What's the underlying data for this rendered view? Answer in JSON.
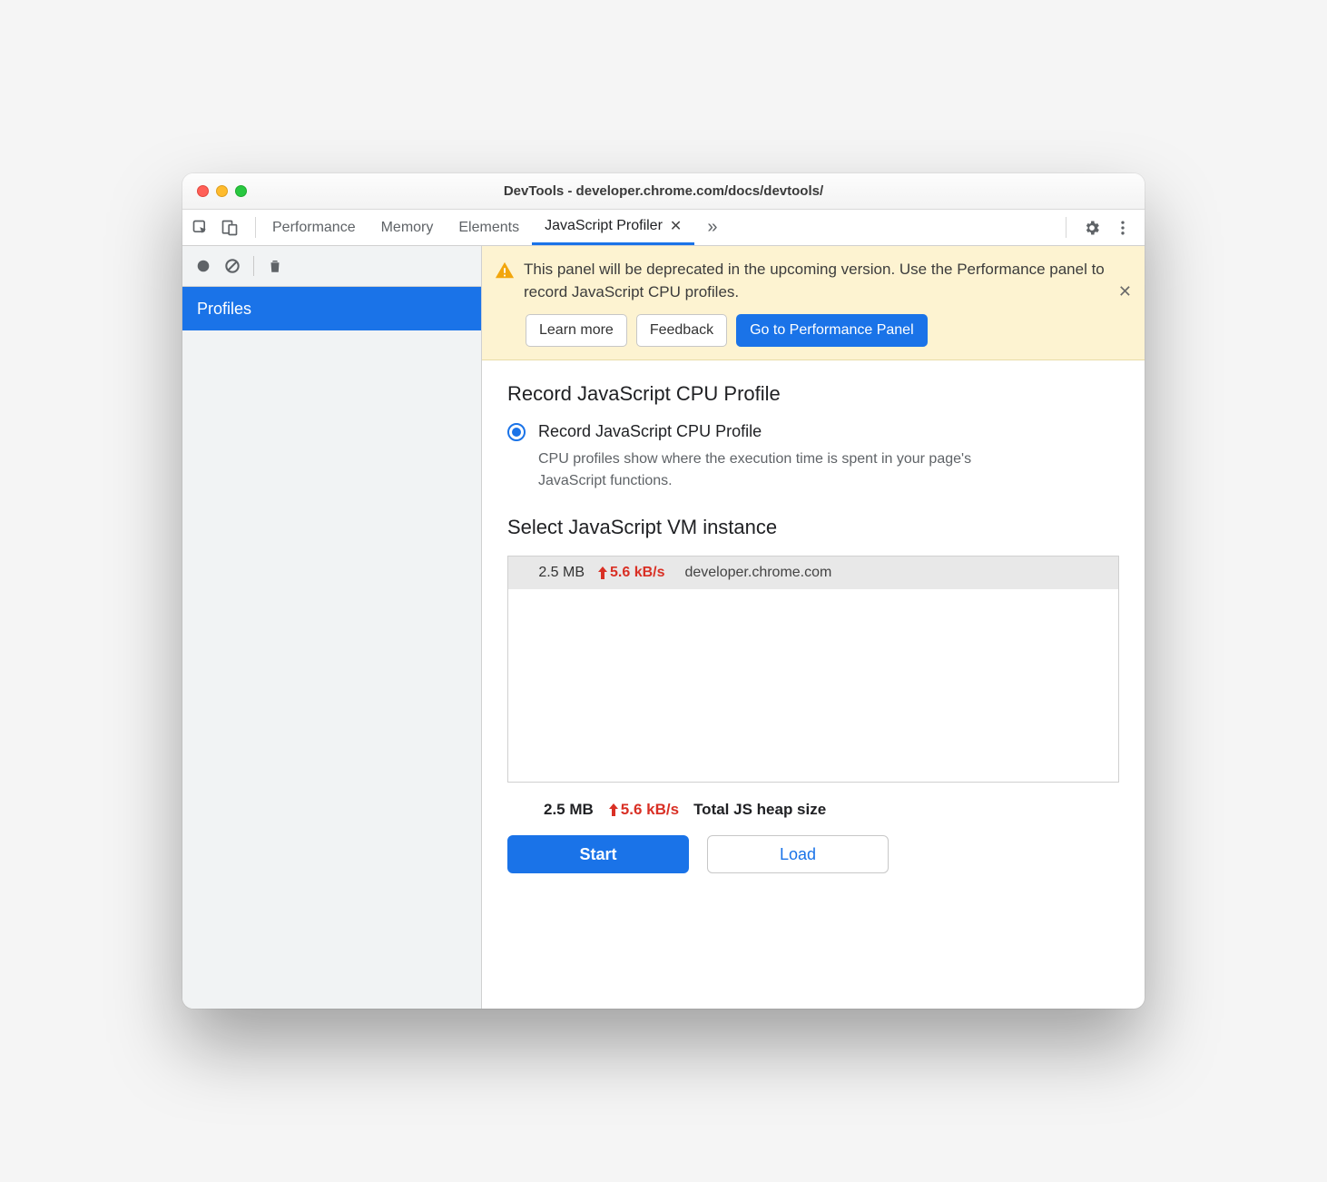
{
  "window": {
    "title": "DevTools - developer.chrome.com/docs/devtools/"
  },
  "tabs": {
    "items": [
      "Performance",
      "Memory",
      "Elements",
      "JavaScript Profiler"
    ],
    "active_index": 3
  },
  "sidebar": {
    "profiles_label": "Profiles"
  },
  "banner": {
    "text": "This panel will be deprecated in the upcoming version. Use the Performance panel to record JavaScript CPU profiles.",
    "learn_more": "Learn more",
    "feedback": "Feedback",
    "goto": "Go to Performance Panel"
  },
  "content": {
    "record_heading": "Record JavaScript CPU Profile",
    "radio_label": "Record JavaScript CPU Profile",
    "radio_desc": "CPU profiles show where the execution time is spent in your page's JavaScript functions.",
    "vm_heading": "Select JavaScript VM instance",
    "vm_row": {
      "size": "2.5 MB",
      "rate": "5.6 kB/s",
      "host": "developer.chrome.com"
    },
    "totals": {
      "size": "2.5 MB",
      "rate": "5.6 kB/s",
      "label": "Total JS heap size"
    },
    "start": "Start",
    "load": "Load"
  }
}
